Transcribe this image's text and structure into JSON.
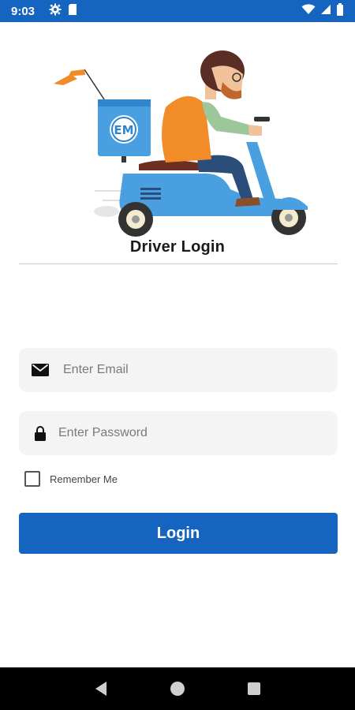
{
  "status_bar": {
    "time": "9:03",
    "icons": [
      "gear-icon",
      "sim-card-icon",
      "wifi-icon",
      "cell-signal-icon",
      "battery-icon"
    ]
  },
  "hero": {
    "illustration": "delivery-scooter-rider-illustration",
    "box_logo": "EM"
  },
  "page": {
    "title": "Driver Login"
  },
  "form": {
    "email": {
      "placeholder": "Enter Email",
      "value": "",
      "icon": "mail-icon"
    },
    "password": {
      "placeholder": "Enter Password",
      "value": "",
      "icon": "lock-icon"
    },
    "remember_label": "Remember Me",
    "remember_checked": false,
    "login_label": "Login"
  },
  "nav_bar": {
    "buttons": [
      "back-icon",
      "home-icon",
      "recents-icon"
    ]
  },
  "colors": {
    "primary": "#1565c0",
    "field_bg": "#f4f4f4",
    "scooter_blue": "#4a9fe0",
    "shirt_orange": "#f28c28"
  }
}
